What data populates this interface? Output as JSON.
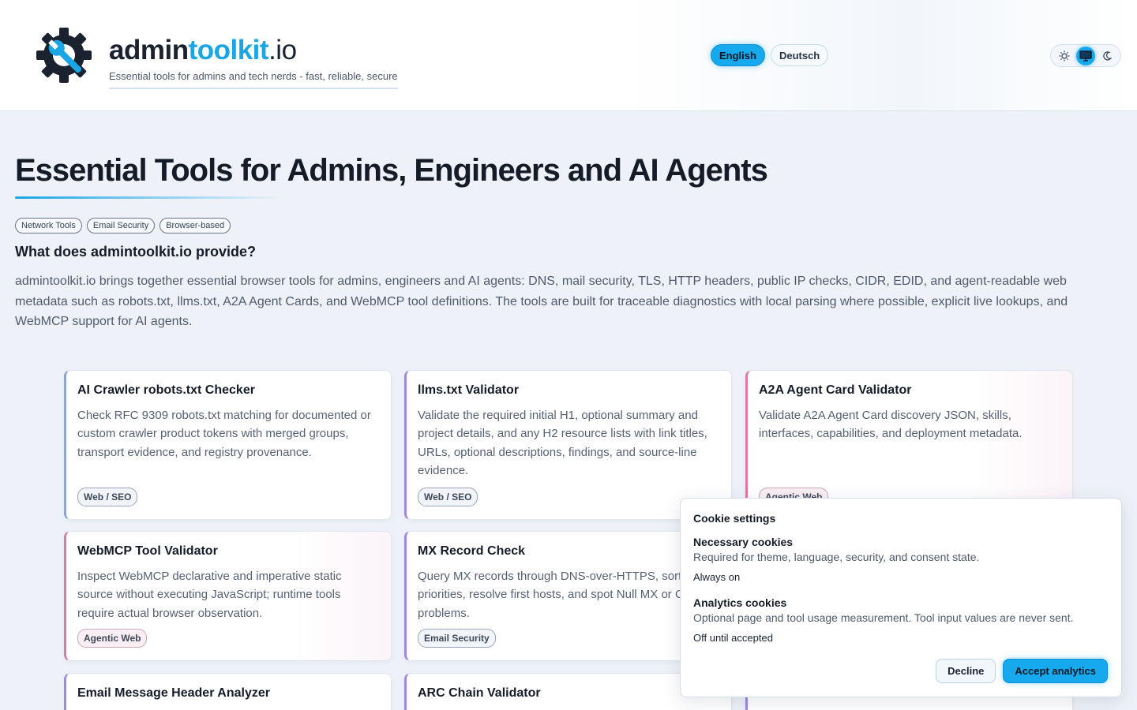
{
  "header": {
    "brand_part1": "admin",
    "brand_part2": "toolkit",
    "brand_part3": ".io",
    "tagline": "Essential tools for admins and tech nerds - fast, reliable, secure",
    "languages": [
      {
        "label": "English",
        "active": true
      },
      {
        "label": "Deutsch",
        "active": false
      }
    ],
    "theme": {
      "selected": "system",
      "options": [
        "sun-icon",
        "monitor-icon",
        "moon-icon"
      ]
    }
  },
  "intro": {
    "title": "Essential Tools for Admins, Engineers and AI Agents",
    "tags": [
      "Network Tools",
      "Email Security",
      "Browser-based"
    ],
    "question": "What does admintoolkit.io provide?",
    "text": "admintoolkit.io brings together essential browser tools for admins, engineers and AI agents: DNS, mail security, TLS, HTTP headers, public IP checks, CIDR, EDID, and agent-readable web metadata such as robots.txt, llms.txt, A2A Agent Cards, and WebMCP tool definitions. The tools are built for traceable diagnostics with local parsing where possible, explicit live lookups, and WebMCP support for AI agents."
  },
  "cards": [
    {
      "title": "AI Crawler robots.txt Checker",
      "desc": "Check RFC 9309 robots.txt matching for documented or custom crawler product tokens with merged groups, transport evidence, and registry provenance.",
      "badge": "Web / SEO"
    },
    {
      "title": "llms.txt Validator",
      "desc": "Validate the required initial H1, optional summary and project details, and any H2 resource lists with link titles, URLs, optional descriptions, findings, and source-line evidence.",
      "badge": "Web / SEO"
    },
    {
      "title": "A2A Agent Card Validator",
      "desc": "Validate A2A Agent Card discovery JSON, skills, interfaces, capabilities, and deployment metadata.",
      "badge": "Agentic Web"
    },
    {
      "title": "WebMCP Tool Validator",
      "desc": "Inspect WebMCP declarative and imperative static source without executing JavaScript; runtime tools require actual browser observation.",
      "badge": "Agentic Web"
    },
    {
      "title": "MX Record Check",
      "desc": "Query MX records through DNS-over-HTTPS, sort priorities, resolve first hosts, and spot Null MX or CNAME problems.",
      "badge": "Email Security"
    },
    {
      "title": "Email Message Header Analyzer",
      "desc": "",
      "badge": ""
    },
    {
      "title": "ARC Chain Validator",
      "desc": "",
      "badge": ""
    }
  ],
  "cookie": {
    "title": "Cookie settings",
    "necessary_title": "Necessary cookies",
    "necessary_desc": "Required for theme, language, security, and consent state.",
    "necessary_state": "Always on",
    "analytics_title": "Analytics cookies",
    "analytics_desc": "Optional page and tool usage measurement. Tool input values are never sent.",
    "analytics_state": "Off until accepted",
    "decline_label": "Decline",
    "accept_label": "Accept analytics"
  },
  "colors": {
    "accent": "#16a9ee",
    "brand_blue": "#1aa6e4",
    "text_dark": "#151c28"
  }
}
